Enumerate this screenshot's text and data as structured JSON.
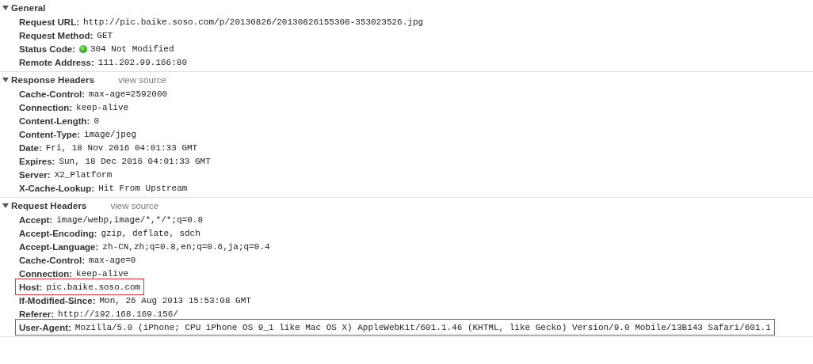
{
  "sections": [
    {
      "title": "General",
      "expanded": true,
      "rows": [
        {
          "name": "Request URL:",
          "value": "http://pic.baike.soso.com/p/20130826/20130826155308-353023526.jpg",
          "kind": "plain",
          "highlighted": false
        },
        {
          "name": "Request Method:",
          "value": "GET",
          "kind": "plain",
          "highlighted": false
        },
        {
          "name": "Status Code:",
          "value": "304 Not Modified",
          "kind": "status",
          "highlighted": false
        },
        {
          "name": "Remote Address:",
          "value": "111.202.99.166:80",
          "kind": "plain",
          "highlighted": false
        }
      ]
    },
    {
      "title": "Response Headers",
      "link": "view source",
      "expanded": true,
      "rows": [
        {
          "name": "Cache-Control:",
          "value": "max-age=2592000",
          "kind": "plain",
          "highlighted": false
        },
        {
          "name": "Connection:",
          "value": "keep-alive",
          "kind": "plain",
          "highlighted": false
        },
        {
          "name": "Content-Length:",
          "value": "0",
          "kind": "plain",
          "highlighted": false
        },
        {
          "name": "Content-Type:",
          "value": "image/jpeg",
          "kind": "plain",
          "highlighted": false
        },
        {
          "name": "Date:",
          "value": "Fri, 18 Nov 2016 04:01:33 GMT",
          "kind": "plain",
          "highlighted": false
        },
        {
          "name": "Expires:",
          "value": "Sun, 18 Dec 2016 04:01:33 GMT",
          "kind": "plain",
          "highlighted": false
        },
        {
          "name": "Server:",
          "value": "X2_Platform",
          "kind": "plain",
          "highlighted": false
        },
        {
          "name": "X-Cache-Lookup:",
          "value": "Hit From Upstream",
          "kind": "plain",
          "highlighted": false
        }
      ]
    },
    {
      "title": "Request Headers",
      "link": "view source",
      "expanded": true,
      "rows": [
        {
          "name": "Accept:",
          "value": "image/webp,image/*,*/*;q=0.8",
          "kind": "plain",
          "highlighted": false
        },
        {
          "name": "Accept-Encoding:",
          "value": "gzip, deflate, sdch",
          "kind": "plain",
          "highlighted": false
        },
        {
          "name": "Accept-Language:",
          "value": "zh-CN,zh;q=0.8,en;q=0.6,ja;q=0.4",
          "kind": "plain",
          "highlighted": false
        },
        {
          "name": "Cache-Control:",
          "value": "max-age=0",
          "kind": "plain",
          "highlighted": false
        },
        {
          "name": "Connection:",
          "value": "keep-alive",
          "kind": "plain",
          "highlighted": false
        },
        {
          "name": "Host:",
          "value": "pic.baike.soso.com",
          "kind": "plain",
          "highlighted": true
        },
        {
          "name": "If-Modified-Since:",
          "value": "Mon, 26 Aug 2013 15:53:08 GMT",
          "kind": "plain",
          "highlighted": false
        },
        {
          "name": "Referer:",
          "value": "http://192.168.169.156/",
          "kind": "plain",
          "highlighted": false
        },
        {
          "name": "User-Agent:",
          "value": "Mozilla/5.0 (iPhone; CPU iPhone OS 9_1 like Mac OS X) AppleWebKit/601.1.46 (KHTML, like Gecko) Version/9.0 Mobile/13B143 Safari/601.1",
          "kind": "plain",
          "highlighted": true
        }
      ]
    }
  ]
}
